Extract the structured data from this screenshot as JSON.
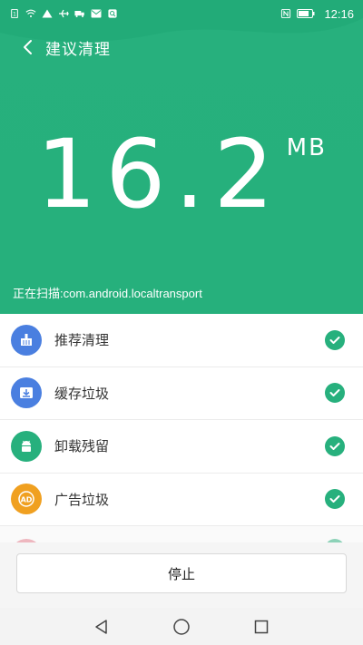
{
  "status_bar": {
    "time": "12:16"
  },
  "header": {
    "title": "建议清理",
    "size_value": "16.2",
    "size_unit": "MB",
    "scan_status": "正在扫描:com.android.localtransport"
  },
  "categories": [
    {
      "label": "推荐清理",
      "icon": "broom-icon",
      "color": "#4a7fe0",
      "checked": true
    },
    {
      "label": "缓存垃圾",
      "icon": "download-tray-icon",
      "color": "#4a7fe0",
      "checked": true
    },
    {
      "label": "卸载残留",
      "icon": "android-icon",
      "color": "#27b07d",
      "checked": true
    },
    {
      "label": "广告垃圾",
      "icon": "ad-icon",
      "color": "#f0a020",
      "checked": true
    }
  ],
  "bottom": {
    "stop_label": "停止"
  },
  "colors": {
    "accent": "#27b07d",
    "blue": "#4a7fe0",
    "orange": "#f0a020"
  }
}
